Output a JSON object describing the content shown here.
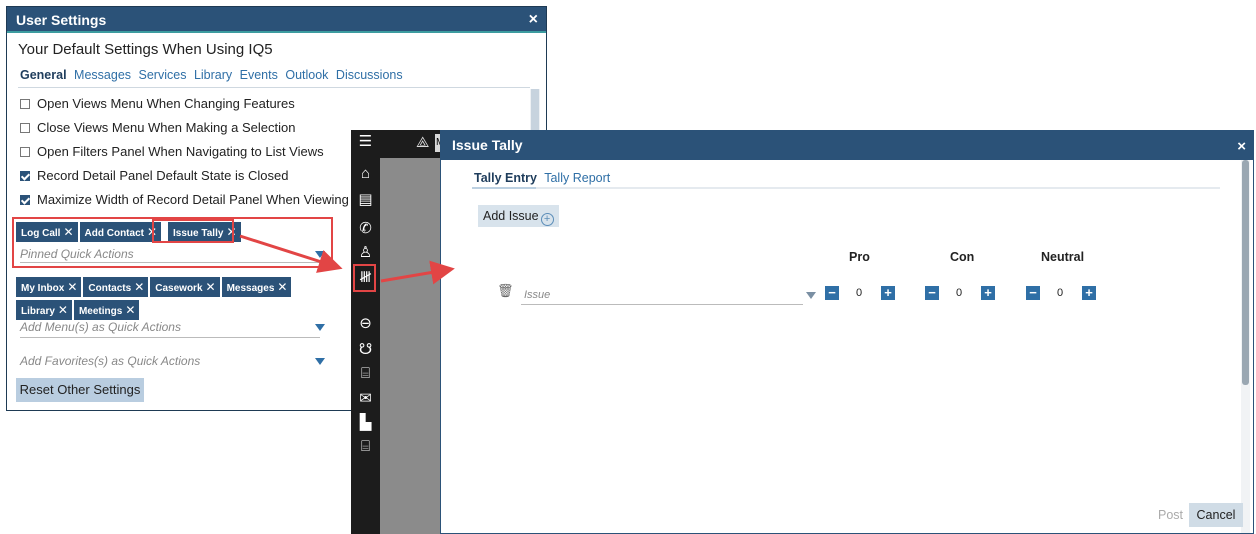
{
  "user_settings": {
    "title": "User Settings",
    "close": "×",
    "heading": "Your Default Settings When Using IQ5",
    "tabs": [
      {
        "label": "General",
        "active": true
      },
      {
        "label": "Messages"
      },
      {
        "label": "Services"
      },
      {
        "label": "Library"
      },
      {
        "label": "Events"
      },
      {
        "label": "Outlook"
      },
      {
        "label": "Discussions"
      }
    ],
    "options": [
      {
        "label": "Open Views Menu When Changing Features",
        "checked": false
      },
      {
        "label": "Close Views Menu When Making a Selection",
        "checked": false
      },
      {
        "label": "Open Filters Panel When Navigating to List Views",
        "checked": false
      },
      {
        "label": "Record Detail Panel Default State is Closed",
        "checked": true
      },
      {
        "label": "Maximize Width of Record Detail Panel When Viewing S",
        "checked": true
      }
    ],
    "pinned_chips": [
      "Log Call",
      "Add Contact",
      "Issue Tally"
    ],
    "pinned_placeholder": "Pinned Quick Actions",
    "menu_chips": [
      "My Inbox",
      "Contacts",
      "Casework",
      "Messages",
      "Library",
      "Meetings"
    ],
    "menu_placeholder": "Add Menu(s) as Quick Actions",
    "favorites_placeholder": "Add Favorites(s) as Quick Actions",
    "reset_label": "Reset Other Settings",
    "chip_close": "✕"
  },
  "app": {
    "my_label": "My"
  },
  "issue_tally": {
    "title": "Issue Tally",
    "close": "×",
    "tabs": [
      {
        "label": "Tally Entry",
        "active": true
      },
      {
        "label": "Tally Report"
      }
    ],
    "add_issue_label": "Add Issue",
    "columns": [
      "Pro",
      "Con",
      "Neutral"
    ],
    "issue_placeholder": "Issue",
    "values": {
      "pro": "0",
      "con": "0",
      "neutral": "0"
    },
    "post_label": "Post",
    "cancel_label": "Cancel"
  },
  "colors": {
    "header": "#2b5278",
    "accent": "#2f6fa6",
    "highlight": "#e24545"
  }
}
